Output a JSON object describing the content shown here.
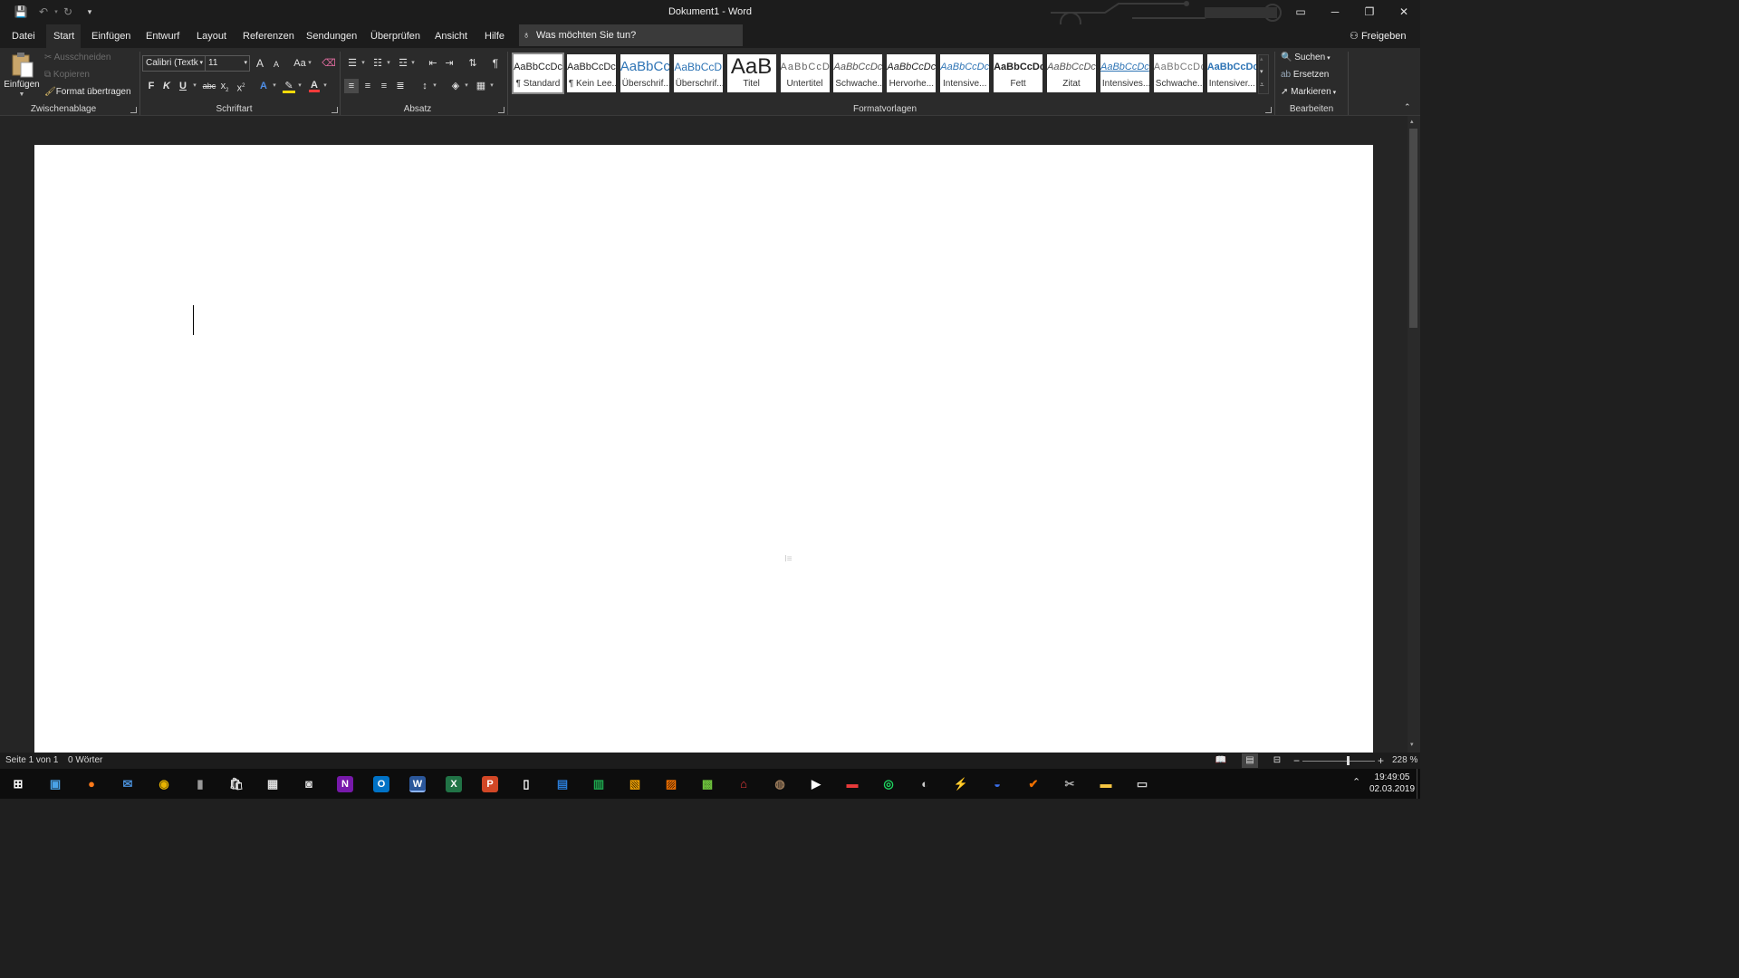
{
  "titlebar": {
    "title": "Dokument1  -  Word",
    "qat": {
      "save": "💾",
      "undo": "↶",
      "redo": "↻",
      "more": "▾"
    },
    "win": {
      "ribbon_display": "▭",
      "minimize": "─",
      "restore": "❐",
      "close": "✕"
    }
  },
  "menu": {
    "tabs": [
      "Datei",
      "Start",
      "Einfügen",
      "Entwurf",
      "Layout",
      "Referenzen",
      "Sendungen",
      "Überprüfen",
      "Ansicht",
      "Hilfe"
    ],
    "tellme": "Was möchten Sie tun?",
    "share": "Freigeben"
  },
  "ribbon": {
    "clipboard": {
      "paste": "Einfügen",
      "cut": "Ausschneiden",
      "copy": "Kopieren",
      "format_painter": "Format übertragen",
      "group": "Zwischenablage"
    },
    "font": {
      "name": "Calibri (Textk",
      "size": "11",
      "grow": "A",
      "shrink": "A",
      "case": "Aa",
      "bold": "F",
      "italic": "K",
      "underline": "U",
      "strike": "abc",
      "sub": "x",
      "sup": "x",
      "group": "Schriftart"
    },
    "paragraph": {
      "group": "Absatz"
    },
    "styles": {
      "group": "Formatvorlagen",
      "items": [
        {
          "preview": "AaBbCcDc",
          "label": "¶ Standard"
        },
        {
          "preview": "AaBbCcDc",
          "label": "¶ Kein Lee..."
        },
        {
          "preview": "AaBbCc",
          "label": "Überschrif..."
        },
        {
          "preview": "AaBbCcD",
          "label": "Überschrif..."
        },
        {
          "preview": "AaB",
          "label": "Titel"
        },
        {
          "preview": "AaBbCcD",
          "label": "Untertitel"
        },
        {
          "preview": "AaBbCcDc",
          "label": "Schwache..."
        },
        {
          "preview": "AaBbCcDc",
          "label": "Hervorhe..."
        },
        {
          "preview": "AaBbCcDc",
          "label": "Intensive..."
        },
        {
          "preview": "AaBbCcDc",
          "label": "Fett"
        },
        {
          "preview": "AaBbCcDc",
          "label": "Zitat"
        },
        {
          "preview": "AaBbCcDc",
          "label": "Intensives..."
        },
        {
          "preview": "AaBbCcDc",
          "label": "Schwache..."
        },
        {
          "preview": "AaBbCcDc",
          "label": "Intensiver..."
        }
      ]
    },
    "editing": {
      "find": "Suchen",
      "replace": "Ersetzen",
      "select": "Markieren",
      "group": "Bearbeiten"
    }
  },
  "status": {
    "page": "Seite 1 von 1",
    "words": "0 Wörter",
    "zoom": "228 %",
    "zoom_level": 0.62
  },
  "taskbar": {
    "time": "19:49:05",
    "date": "02.03.2019",
    "active_app": "Word"
  },
  "colors": {
    "accent": "#2b579a",
    "highlight": "#f5d90a",
    "font_color": "#ff3b3b"
  }
}
